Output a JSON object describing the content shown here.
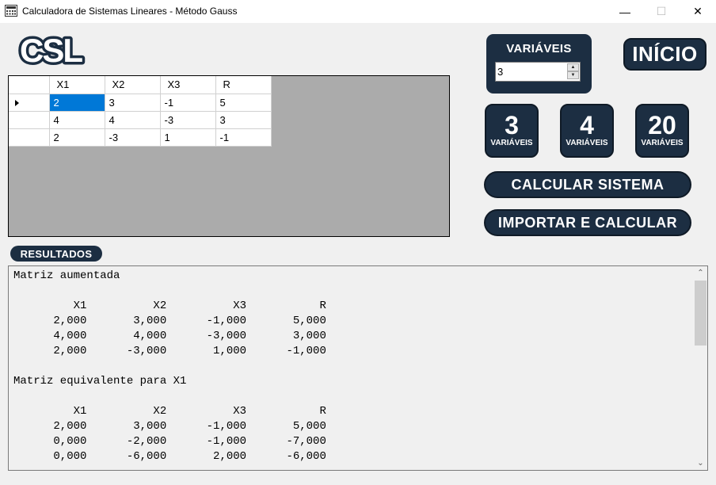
{
  "window": {
    "title": "Calculadora de Sistemas Lineares - Método Gauss",
    "minimize_glyph": "—",
    "maximize_glyph": "☐",
    "close_glyph": "✕"
  },
  "logo": {
    "text": "CSL"
  },
  "grid": {
    "columns": [
      "X1",
      "X2",
      "X3",
      "R"
    ],
    "rows": [
      [
        "2",
        "3",
        "-1",
        "5"
      ],
      [
        "4",
        "4",
        "-3",
        "3"
      ],
      [
        "2",
        "-3",
        "1",
        "-1"
      ]
    ],
    "selected_cell": "row 1, column X1"
  },
  "variables": {
    "title": "VARIÁVEIS",
    "value": "3",
    "spin_up": "▲",
    "spin_down": "▼"
  },
  "buttons": {
    "inicio": "INÍCIO",
    "var3_num": "3",
    "var4_num": "4",
    "var20_num": "20",
    "var_label": "VARIÁVEIS",
    "calcular": "CALCULAR SISTEMA",
    "importar": "IMPORTAR E CALCULAR"
  },
  "results": {
    "label": "RESULTADOS",
    "lines": [
      "Matriz aumentada",
      "",
      "         X1          X2          X3           R",
      "      2,000       3,000      -1,000       5,000",
      "      4,000       4,000      -3,000       3,000",
      "      2,000      -3,000       1,000      -1,000",
      "",
      "Matriz equivalente para X1",
      "",
      "         X1          X2          X3           R",
      "      2,000       3,000      -1,000       5,000",
      "      0,000      -2,000      -1,000      -7,000",
      "      0,000      -6,000       2,000      -6,000"
    ],
    "scroll_up": "⌃",
    "scroll_down": "⌄"
  },
  "colors": {
    "accent_dark": "#1c2e42",
    "selection": "#0078d7",
    "grid_bg": "#ababab"
  }
}
